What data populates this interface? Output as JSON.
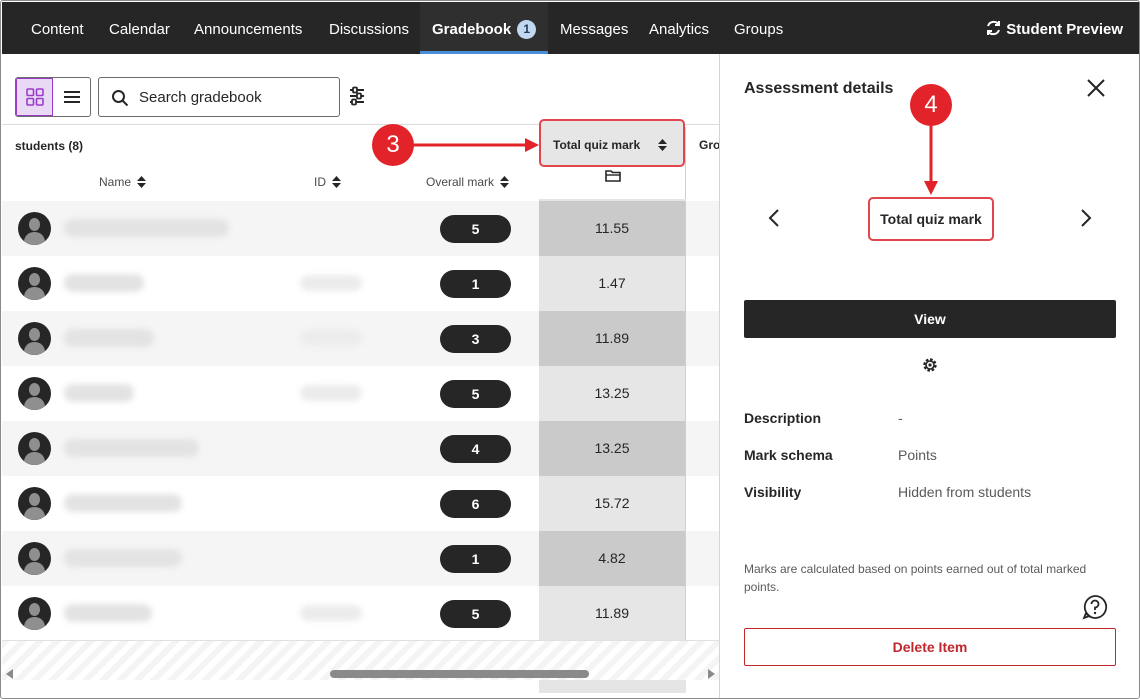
{
  "nav": {
    "items": [
      {
        "label": "Content"
      },
      {
        "label": "Calendar"
      },
      {
        "label": "Announcements"
      },
      {
        "label": "Discussions"
      },
      {
        "label": "Gradebook",
        "badge": "1"
      },
      {
        "label": "Messages"
      },
      {
        "label": "Analytics"
      },
      {
        "label": "Groups"
      }
    ],
    "student_preview": "Student Preview"
  },
  "gradebook": {
    "search_placeholder": "Search gradebook",
    "students_count": "students (8)",
    "columns": {
      "name": "Name",
      "id": "ID",
      "overall": "Overall mark",
      "quiz": "Total quiz mark",
      "next_partial": "Gro"
    },
    "rows": [
      {
        "overall": "5",
        "quiz": "11.55"
      },
      {
        "overall": "1",
        "quiz": "1.47"
      },
      {
        "overall": "3",
        "quiz": "11.89"
      },
      {
        "overall": "5",
        "quiz": "13.25"
      },
      {
        "overall": "4",
        "quiz": "13.25"
      },
      {
        "overall": "6",
        "quiz": "15.72"
      },
      {
        "overall": "1",
        "quiz": "4.82"
      },
      {
        "overall": "5",
        "quiz": "11.89"
      }
    ]
  },
  "panel": {
    "title": "Assessment details",
    "item_name": "Total quiz mark",
    "view_label": "View",
    "description_label": "Description",
    "description_value": "-",
    "schema_label": "Mark schema",
    "schema_value": "Points",
    "visibility_label": "Visibility",
    "visibility_value": "Hidden from students",
    "note": "Marks are calculated based on points earned out of total marked points.",
    "delete_label": "Delete Item"
  },
  "annotations": {
    "step3": "3",
    "step4": "4"
  },
  "colors": {
    "nav_bg": "#262626",
    "accent_purple": "#9a3cc9",
    "annotation_red": "#e2232a",
    "delete_red": "#c0272d"
  }
}
